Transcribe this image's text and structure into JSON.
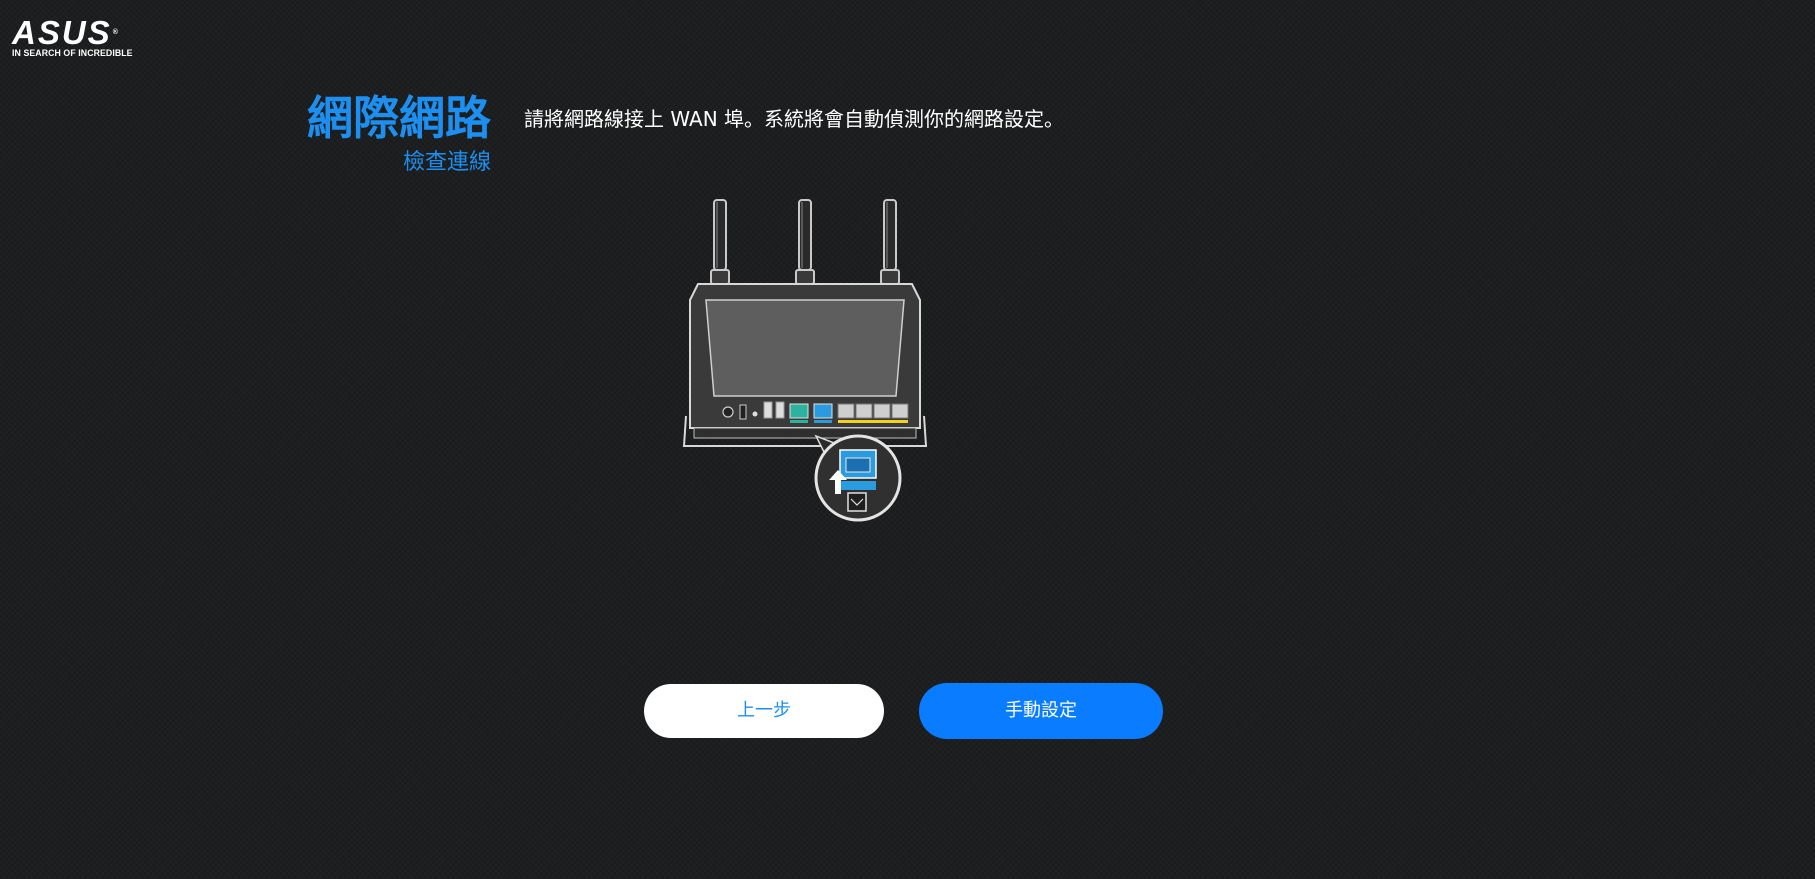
{
  "brand": {
    "name": "ASUS",
    "registered_mark": "®",
    "tagline": "IN SEARCH OF INCREDIBLE"
  },
  "header": {
    "title": "網際網路",
    "subtitle": "檢查連線"
  },
  "main": {
    "instruction": "請將網路線接上 WAN 埠。系統將會自動偵測你的網路設定。"
  },
  "buttons": {
    "back_label": "上一步",
    "manual_label": "手動設定"
  },
  "colors": {
    "accent": "#1c8ff0",
    "primary_button": "#0a7cff",
    "background": "#1d1e1f",
    "wan_port": "#2b9be0",
    "lan_port": "#f2d21b",
    "usb_port": "#2bb3a0"
  },
  "icons": {
    "router": "router-illustration",
    "wan_port_zoom": "wan-port-zoom-icon",
    "arrow_up": "arrow-up-icon"
  }
}
